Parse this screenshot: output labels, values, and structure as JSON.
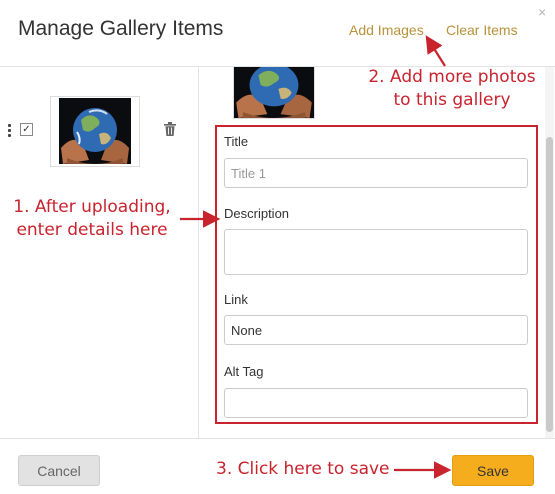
{
  "header": {
    "title": "Manage Gallery Items",
    "add_images_label": "Add Images",
    "clear_items_label": "Clear Items",
    "close_icon": "×"
  },
  "gallery": {
    "items": [
      {
        "checked": true,
        "thumbnail": "earth-in-hands-image"
      }
    ]
  },
  "form": {
    "title_label": "Title",
    "title_placeholder": "Title 1",
    "description_label": "Description",
    "description_value": "",
    "link_label": "Link",
    "link_value": "None",
    "alt_tag_label": "Alt Tag",
    "alt_tag_value": ""
  },
  "footer": {
    "cancel_label": "Cancel",
    "save_label": "Save"
  },
  "annotations": {
    "step1_line1": "1. After uploading,",
    "step1_line2": "enter details here",
    "step2_line1": "2. Add more photos",
    "step2_line2": "to this gallery",
    "step3": "3. Click here to save"
  },
  "colors": {
    "accent_link": "#b8923c",
    "annotation_red": "#c9232e",
    "save_button": "#f5ad1d"
  }
}
